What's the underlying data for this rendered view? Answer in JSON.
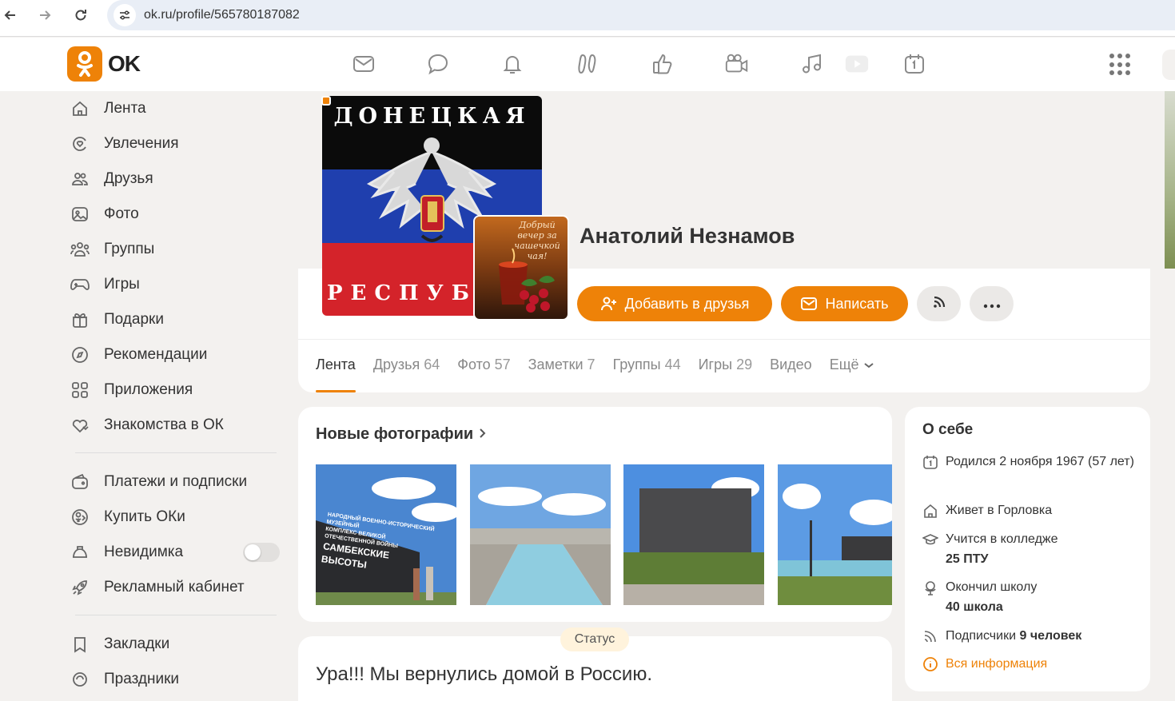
{
  "browser": {
    "url": "ok.ru/profile/565780187082",
    "back_icon": "arrow-left-icon",
    "forward_icon": "arrow-right-icon",
    "reload_icon": "reload-icon"
  },
  "header": {
    "logo_text": "OK",
    "brand_color": "#ee8208",
    "icons": [
      "mail-icon",
      "chat-icon",
      "bell-icon",
      "guests-icon",
      "like-icon",
      "video-camera-icon",
      "music-icon",
      "play-icon",
      "calendar-icon",
      "apps-grid-icon"
    ]
  },
  "sidebar": {
    "items": [
      {
        "label": "Лента",
        "icon": "home-icon"
      },
      {
        "label": "Увлечения",
        "icon": "hobby-icon"
      },
      {
        "label": "Друзья",
        "icon": "friends-icon"
      },
      {
        "label": "Фото",
        "icon": "photo-icon"
      },
      {
        "label": "Группы",
        "icon": "groups-icon"
      },
      {
        "label": "Игры",
        "icon": "gamepad-icon"
      },
      {
        "label": "Подарки",
        "icon": "gift-icon"
      },
      {
        "label": "Рекомендации",
        "icon": "compass-icon"
      },
      {
        "label": "Приложения",
        "icon": "apps-icon"
      },
      {
        "label": "Знакомства в ОК",
        "icon": "dating-icon"
      }
    ],
    "items2": [
      {
        "label": "Платежи и подписки",
        "icon": "wallet-icon"
      },
      {
        "label": "Купить ОКи",
        "icon": "coin-icon"
      },
      {
        "label": "Невидимка",
        "icon": "invisible-icon",
        "toggle": false
      },
      {
        "label": "Рекламный кабинет",
        "icon": "rocket-icon"
      }
    ],
    "items3": [
      {
        "label": "Закладки",
        "icon": "bookmark-icon"
      },
      {
        "label": "Праздники",
        "icon": "holiday-icon"
      }
    ]
  },
  "profile": {
    "name": "Анатолий Незнамов",
    "flag_title": "ДОНЕЦКАЯ",
    "flag_bottom": "РЕСПУБЛИКА",
    "add_friend_label": "Добавить в друзья",
    "write_label": "Написать",
    "small_avatar_caption": "Добрый вечер за чашечкой чая!"
  },
  "tabs": [
    {
      "label": "Лента",
      "count": ""
    },
    {
      "label": "Друзья",
      "count": "64"
    },
    {
      "label": "Фото",
      "count": "57"
    },
    {
      "label": "Заметки",
      "count": "7"
    },
    {
      "label": "Группы",
      "count": "44"
    },
    {
      "label": "Игры",
      "count": "29"
    },
    {
      "label": "Видео",
      "count": ""
    },
    {
      "label": "Ещё",
      "count": ""
    }
  ],
  "photos": {
    "title": "Новые фотографии",
    "sign_line1": "НАРОДНЫЙ ВОЕННО-ИСТОРИЧЕСКИЙ МУЗЕЙНЫЙ",
    "sign_line2": "КОМПЛЕКС ВЕЛИКОЙ ОТЕЧЕСТВЕННОЙ ВОЙНЫ",
    "sign_line3": "САМБЕКСКИЕ ВЫСОТЫ"
  },
  "about": {
    "title": "О себе",
    "born": "Родился 2 ноября 1967 (57 лет)",
    "lives": "Живет в Горловка",
    "studies_prefix": "Учится в колледже",
    "studies_value": "25 ПТУ",
    "school_prefix": "Окончил школу",
    "school_value": "40 школа",
    "subs_prefix": "Подписчики",
    "subs_value": "9 человек",
    "all_info": "Вся информация"
  },
  "status": {
    "badge": "Статус",
    "text": "Ура!!! Мы вернулись домой в Россию."
  }
}
